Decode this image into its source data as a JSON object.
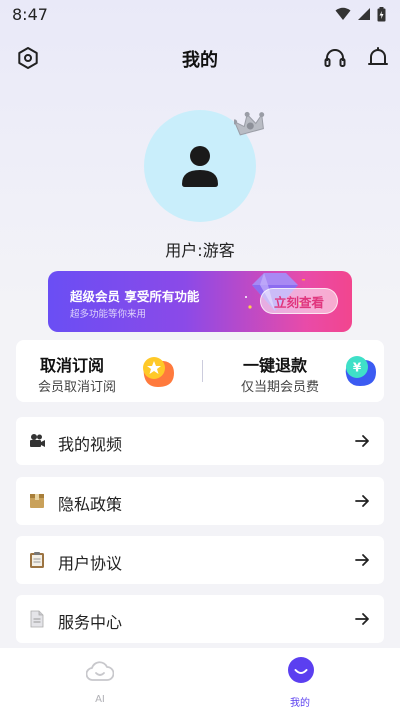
{
  "status_bar": {
    "time": "8:47"
  },
  "header": {
    "title": "我的"
  },
  "profile": {
    "username": "用户:游客"
  },
  "vip_banner": {
    "title": "超级会员 享受所有功能",
    "subtitle": "超多功能等你来用",
    "button_label": "立刻查看"
  },
  "quick_actions": [
    {
      "title": "取消订阅",
      "subtitle": "会员取消订阅"
    },
    {
      "title": "一键退款",
      "subtitle": "仅当期会员费"
    }
  ],
  "menu": [
    {
      "label": "我的视频",
      "icon": "video-camera-icon"
    },
    {
      "label": "隐私政策",
      "icon": "package-icon"
    },
    {
      "label": "用户协议",
      "icon": "clipboard-icon"
    },
    {
      "label": "服务中心",
      "icon": "document-icon"
    }
  ],
  "bottom_nav": [
    {
      "label": "AI",
      "active": false
    },
    {
      "label": "我的",
      "active": true
    }
  ],
  "colors": {
    "accent": "#5b3ff0",
    "vip_gradient_start": "#6a4ef4",
    "vip_gradient_end": "#f2458e",
    "avatar_bg": "#c9eefb"
  }
}
